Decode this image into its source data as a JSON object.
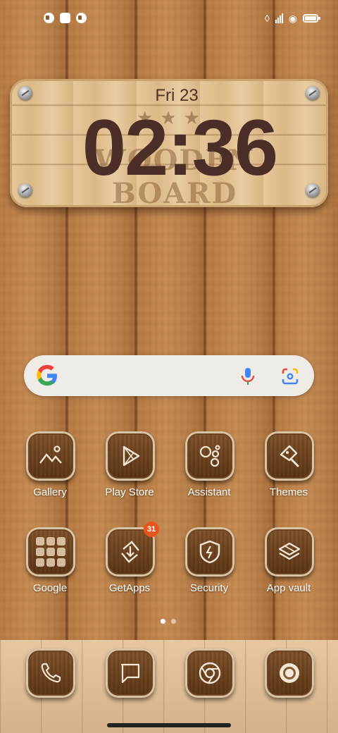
{
  "clock": {
    "date": "Fri 23",
    "time": "02:36",
    "stamp": "WOODEN BOARD"
  },
  "apps": [
    {
      "label": "Gallery",
      "icon": "gallery-icon"
    },
    {
      "label": "Play Store",
      "icon": "play-store-icon"
    },
    {
      "label": "Assistant",
      "icon": "assistant-icon"
    },
    {
      "label": "Themes",
      "icon": "themes-icon"
    },
    {
      "label": "Google",
      "icon": "google-folder-icon"
    },
    {
      "label": "GetApps",
      "icon": "getapps-icon",
      "badge": "31"
    },
    {
      "label": "Security",
      "icon": "security-icon"
    },
    {
      "label": "App vault",
      "icon": "app-vault-icon"
    }
  ],
  "dock": [
    {
      "icon": "phone-icon"
    },
    {
      "icon": "messages-icon"
    },
    {
      "icon": "chrome-icon"
    },
    {
      "icon": "camera-icon"
    }
  ],
  "colors": {
    "clock_text": "#4b2e27",
    "badge": "#e8561f",
    "search_bg": "#efece8"
  },
  "pages": {
    "count": 2,
    "current": 1
  }
}
